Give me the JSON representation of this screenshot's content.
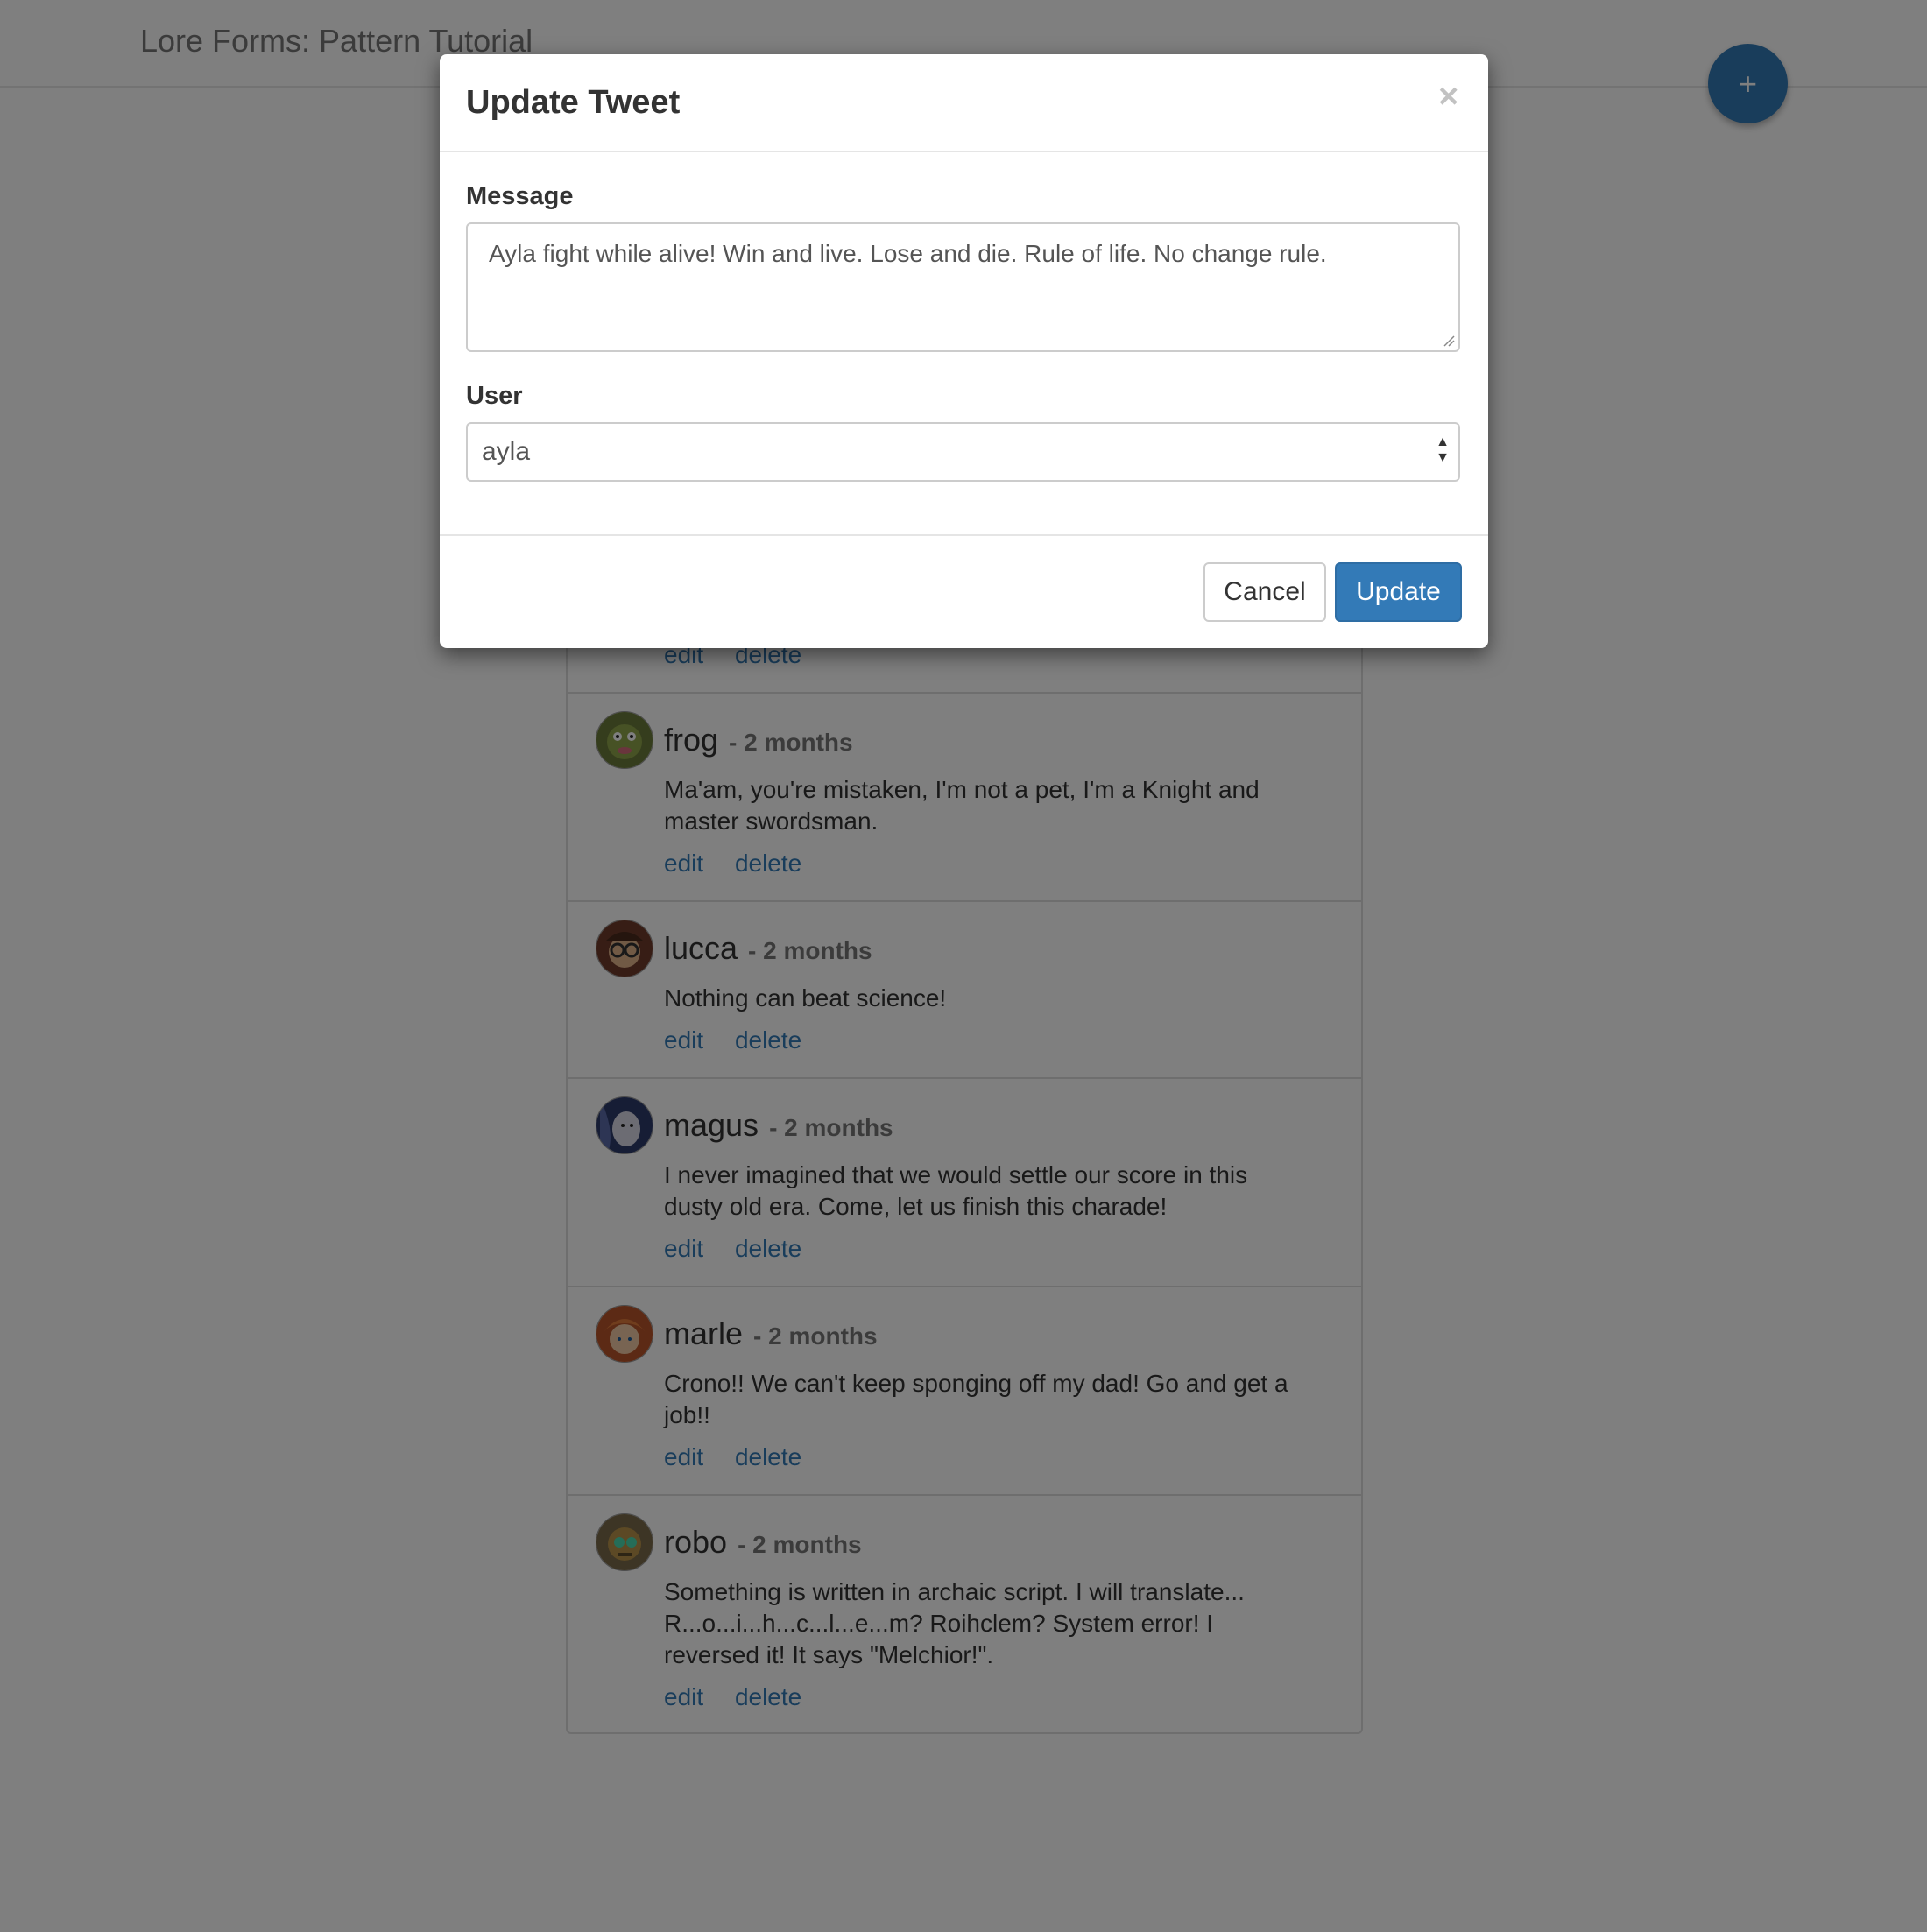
{
  "navbar": {
    "brand": "Lore Forms: Pattern Tutorial",
    "add_button_label": "+"
  },
  "tweets": [
    {
      "user": "frog",
      "time": "- 2 months",
      "message": "Ma'am, you're mistaken, I'm not a pet, I'm a Knight and master swordsman.",
      "edit": "edit",
      "delete": "delete"
    },
    {
      "user": "lucca",
      "time": "- 2 months",
      "message": "Nothing can beat science!",
      "edit": "edit",
      "delete": "delete"
    },
    {
      "user": "magus",
      "time": "- 2 months",
      "message": "I never imagined that we would settle our score in this dusty old era. Come, let us finish this charade!",
      "edit": "edit",
      "delete": "delete"
    },
    {
      "user": "marle",
      "time": "- 2 months",
      "message": "Crono!! We can't keep sponging off my dad! Go and get a job!!",
      "edit": "edit",
      "delete": "delete"
    },
    {
      "user": "robo",
      "time": "- 2 months",
      "message": "Something is written in archaic script. I will translate... R...o...i...h...c...l...e...m? Roihclem? System error! I reversed it! It says \"Melchior!\".",
      "edit": "edit",
      "delete": "delete"
    }
  ],
  "partial_row": {
    "edit": "edit",
    "delete": "delete"
  },
  "modal": {
    "title": "Update Tweet",
    "close_label": "×",
    "message_label": "Message",
    "message_value": "Ayla fight while alive! Win and live. Lose and die. Rule of life. No change rule.",
    "user_label": "User",
    "user_value": "ayla",
    "cancel_label": "Cancel",
    "update_label": "Update"
  },
  "colors": {
    "primary": "#337ab7",
    "link": "#337ab7",
    "backdrop": "rgba(0,0,0,0.5)"
  },
  "icons": {
    "add": "plus-icon",
    "close": "close-icon",
    "select": "select-arrows-icon"
  }
}
